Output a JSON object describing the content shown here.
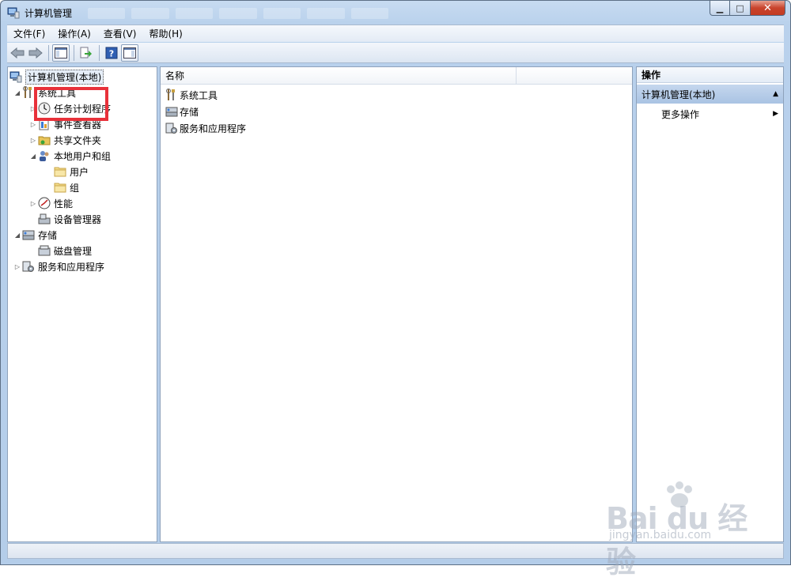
{
  "window": {
    "title": "计算机管理"
  },
  "menu": [
    "文件(F)",
    "操作(A)",
    "查看(V)",
    "帮助(H)"
  ],
  "tree": {
    "root": "计算机管理(本地)",
    "system_tools": "系统工具",
    "task_scheduler": "任务计划程序",
    "event_viewer": "事件查看器",
    "shared_folders": "共享文件夹",
    "local_users_groups": "本地用户和组",
    "users": "用户",
    "groups": "组",
    "performance": "性能",
    "device_manager": "设备管理器",
    "storage": "存储",
    "disk_management": "磁盘管理",
    "services_apps": "服务和应用程序"
  },
  "list": {
    "column_name": "名称",
    "items": [
      "系统工具",
      "存储",
      "服务和应用程序"
    ]
  },
  "actions": {
    "header": "操作",
    "section": "计算机管理(本地)",
    "more": "更多操作"
  },
  "watermark": {
    "main": "Bai du 经验",
    "sub": "jingyan.baidu.com"
  },
  "colors": {
    "highlight": "#e8313a",
    "titlebar": "#c7dbf1",
    "section": "#a9c3e3"
  }
}
